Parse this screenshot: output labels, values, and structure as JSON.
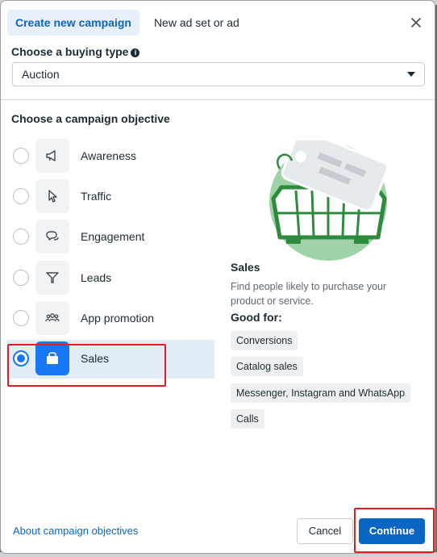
{
  "tabs": [
    {
      "label": "Create new campaign",
      "active": true
    },
    {
      "label": "New ad set or ad",
      "active": false
    }
  ],
  "buying_type": {
    "label": "Choose a buying type",
    "selected": "Auction"
  },
  "objective": {
    "heading": "Choose a campaign objective",
    "items": [
      {
        "label": "Awareness",
        "icon": "megaphone-icon",
        "selected": false
      },
      {
        "label": "Traffic",
        "icon": "cursor-icon",
        "selected": false
      },
      {
        "label": "Engagement",
        "icon": "chat-bubble-icon",
        "selected": false
      },
      {
        "label": "Leads",
        "icon": "funnel-icon",
        "selected": false
      },
      {
        "label": "App promotion",
        "icon": "people-icon",
        "selected": false
      },
      {
        "label": "Sales",
        "icon": "shopping-bag-icon",
        "selected": true
      }
    ]
  },
  "detail": {
    "title": "Sales",
    "description": "Find people likely to purchase your product or service.",
    "good_for_label": "Good for:",
    "good_for": [
      "Conversions",
      "Catalog sales",
      "Messenger, Instagram and WhatsApp",
      "Calls"
    ]
  },
  "footer": {
    "about_link": "About campaign objectives",
    "cancel": "Cancel",
    "continue": "Continue"
  },
  "colors": {
    "accent": "#0a66c2",
    "selected_row": "#e1ecf7",
    "highlight": "#e02020",
    "illustration_bg": "#9fd3a7"
  }
}
